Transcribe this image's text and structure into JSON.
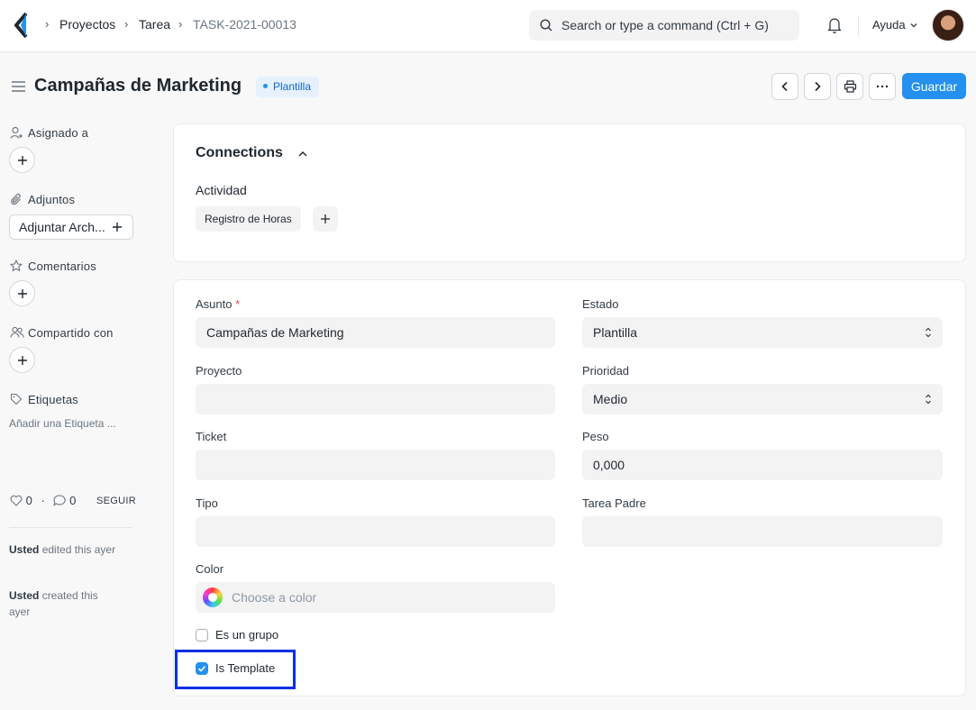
{
  "navbar": {
    "breadcrumbs": [
      "Proyectos",
      "Tarea",
      "TASK-2021-00013"
    ],
    "search_placeholder": "Search or type a command (Ctrl + G)",
    "help_label": "Ayuda"
  },
  "page": {
    "title": "Campañas de Marketing",
    "status_badge": "Plantilla",
    "save_label": "Guardar"
  },
  "sidebar": {
    "assigned_label": "Asignado a",
    "attachments_label": "Adjuntos",
    "attach_button": "Adjuntar Arch...",
    "comments_label": "Comentarios",
    "shared_label": "Compartido con",
    "tags_label": "Etiquetas",
    "add_tag": "Añadir una Etiqueta ...",
    "likes_count": "0",
    "comments_count": "0",
    "follow_label": "SEGUIR",
    "timeline": [
      {
        "user": "Usted",
        "text": "edited this ayer"
      },
      {
        "user": "Usted",
        "text": "created this ayer"
      }
    ]
  },
  "connections": {
    "title": "Connections",
    "group_label": "Actividad",
    "items": [
      "Registro de Horas"
    ]
  },
  "form": {
    "subject_label": "Asunto",
    "subject_value": "Campañas de Marketing",
    "status_label": "Estado",
    "status_value": "Plantilla",
    "project_label": "Proyecto",
    "project_value": "",
    "priority_label": "Prioridad",
    "priority_value": "Medio",
    "ticket_label": "Ticket",
    "ticket_value": "",
    "weight_label": "Peso",
    "weight_value": "0,000",
    "type_label": "Tipo",
    "type_value": "",
    "parent_label": "Tarea Padre",
    "parent_value": "",
    "color_label": "Color",
    "color_placeholder": "Choose a color",
    "is_group_label": "Es un grupo",
    "is_group_checked": false,
    "is_template_label": "Is Template",
    "is_template_checked": true
  },
  "colors": {
    "primary": "#2490ef",
    "highlight_border": "#0a2fe6",
    "badge_bg": "#e6f1fd",
    "badge_text": "#1366c8"
  },
  "icons": [
    "back-logo-icon",
    "search-icon",
    "bell-icon",
    "chevron-down-icon",
    "menu-icon",
    "chevron-left-icon",
    "chevron-right-icon",
    "printer-icon",
    "more-icon",
    "user-plus-icon",
    "paperclip-icon",
    "star-icon",
    "users-icon",
    "tag-icon",
    "heart-icon",
    "comment-icon",
    "plus-icon",
    "chevron-up-icon",
    "select-arrows-icon",
    "color-wheel-icon",
    "check-icon"
  ]
}
